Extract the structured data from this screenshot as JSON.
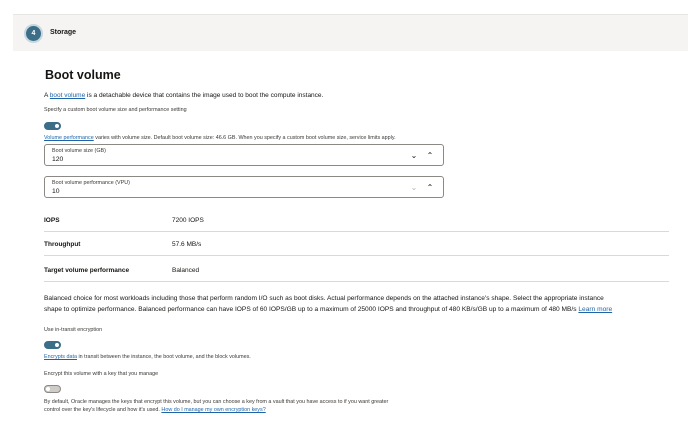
{
  "step": {
    "number": "4",
    "title": "Storage"
  },
  "section_title": "Boot volume",
  "intro": {
    "prefix": "A ",
    "link": "boot volume",
    "suffix": " is a detachable device that contains the image used to boot the compute instance."
  },
  "custom_size_label": "Specify a custom boot volume size and performance setting",
  "custom_size_toggle": "on",
  "perf_note": {
    "link": "Volume performance",
    "suffix": " varies with volume size. Default boot volume size: 46.6 GB. When you specify a custom boot volume size, service limits apply."
  },
  "size_field": {
    "label": "Boot volume size (GB)",
    "value": "120"
  },
  "vpu_field": {
    "label": "Boot volume performance (VPU)",
    "value": "10"
  },
  "stats": [
    {
      "key": "IOPS",
      "value": "7200 IOPS"
    },
    {
      "key": "Throughput",
      "value": "57.6 MB/s"
    },
    {
      "key": "Target volume performance",
      "value": "Balanced"
    }
  ],
  "balanced_desc": {
    "line1": "Balanced choice for most workloads including those that perform random I/O such as boot disks. Actual performance depends on the attached instance's shape. Select the appropriate instance",
    "line2": "shape to optimize performance. Balanced performance can have IOPS of 60 IOPS/GB up to a maximum of 25000 IOPS and throughput of 480 KB/s/GB up to a maximum of 480 MB/s ",
    "link": "Learn more"
  },
  "transit_label": "Use in-transit encryption",
  "transit_toggle": "on",
  "transit_note": {
    "link": "Encrypts data",
    "suffix": " in transit between the instance, the boot volume, and the block volumes."
  },
  "own_key_label": "Encrypt this volume with a key that you manage",
  "own_key_toggle": "off",
  "own_key_note": {
    "line1": "By default, Oracle manages the keys that encrypt this volume, but you can choose a key from a vault that you have access to if you want greater",
    "line2": "control over the key's lifecycle and how it's used. ",
    "link": "How do I manage my own encryption keys?"
  },
  "colors": {
    "accent": "#3d6e87",
    "link": "#1e64a8"
  }
}
